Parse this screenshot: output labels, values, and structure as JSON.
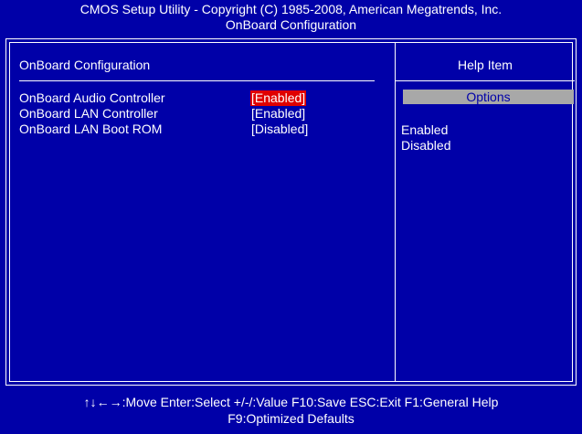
{
  "header": {
    "line1": "CMOS Setup Utility - Copyright (C) 1985-2008, American Megatrends, Inc.",
    "line2": "OnBoard Configuration"
  },
  "left_panel": {
    "title": "OnBoard Configuration",
    "items": [
      {
        "label": "OnBoard Audio Controller",
        "value": "[Enabled]",
        "selected": true
      },
      {
        "label": "OnBoard LAN Controller",
        "value": "[Enabled]",
        "selected": false
      },
      {
        "label": "OnBoard LAN Boot ROM",
        "value": "[Disabled]",
        "selected": false
      }
    ]
  },
  "right_panel": {
    "title": "Help Item",
    "options_label": "Options",
    "options": [
      "Enabled",
      "Disabled"
    ]
  },
  "footer": {
    "line1": "↑↓←→:Move   Enter:Select   +/-/:Value   F10:Save   ESC:Exit   F1:General Help",
    "line2": "F9:Optimized Defaults"
  },
  "colors": {
    "background": "#0000a8",
    "text": "#ffffff",
    "selection": "#e00000",
    "options_bar": "#a8a8a8"
  }
}
